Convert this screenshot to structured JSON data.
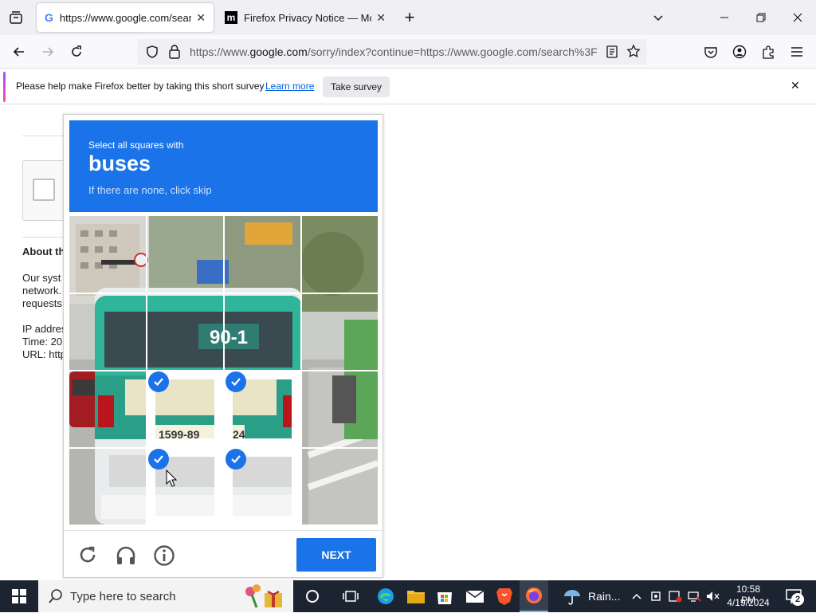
{
  "browser": {
    "tabs": [
      {
        "title": "https://www.google.com/search",
        "icon": "google-g-icon",
        "active": true
      },
      {
        "title": "Firefox Privacy Notice — Mozill",
        "icon": "mozilla-m-icon",
        "active": false
      }
    ],
    "new_tab_glyph": "+",
    "url_prefix": "https://www.",
    "url_domain": "google.com",
    "url_rest": "/sorry/index?continue=https://www.google.com/search%3F"
  },
  "notification": {
    "message": "Please help make Firefox better by taking this short survey",
    "link": "Learn more",
    "button": "Take survey"
  },
  "page_behind": {
    "heading": "About th",
    "paragraph_lines": [
      "Our syst",
      "network.",
      "requests"
    ],
    "meta_lines": [
      "IP addres",
      "Time: 20",
      "URL: http"
    ]
  },
  "captcha": {
    "instruction": "Select all squares with",
    "target": "buses",
    "hint": "If there are none, click skip",
    "next_label": "NEXT",
    "bus_route": "90-1",
    "plate_left": "1599-89",
    "plate_right": "24",
    "selected_cells": [
      [
        2,
        1
      ],
      [
        2,
        2
      ],
      [
        3,
        1
      ],
      [
        3,
        2
      ]
    ]
  },
  "taskbar": {
    "search_placeholder": "Type here to search",
    "weather": "Rain...",
    "time": "10:58 PM",
    "date": "4/19/2024",
    "notifications_count": "2"
  },
  "colors": {
    "captcha_blue": "#1a73e8",
    "taskbar": "#1c2331",
    "tabbar": "#f0f0f4"
  }
}
